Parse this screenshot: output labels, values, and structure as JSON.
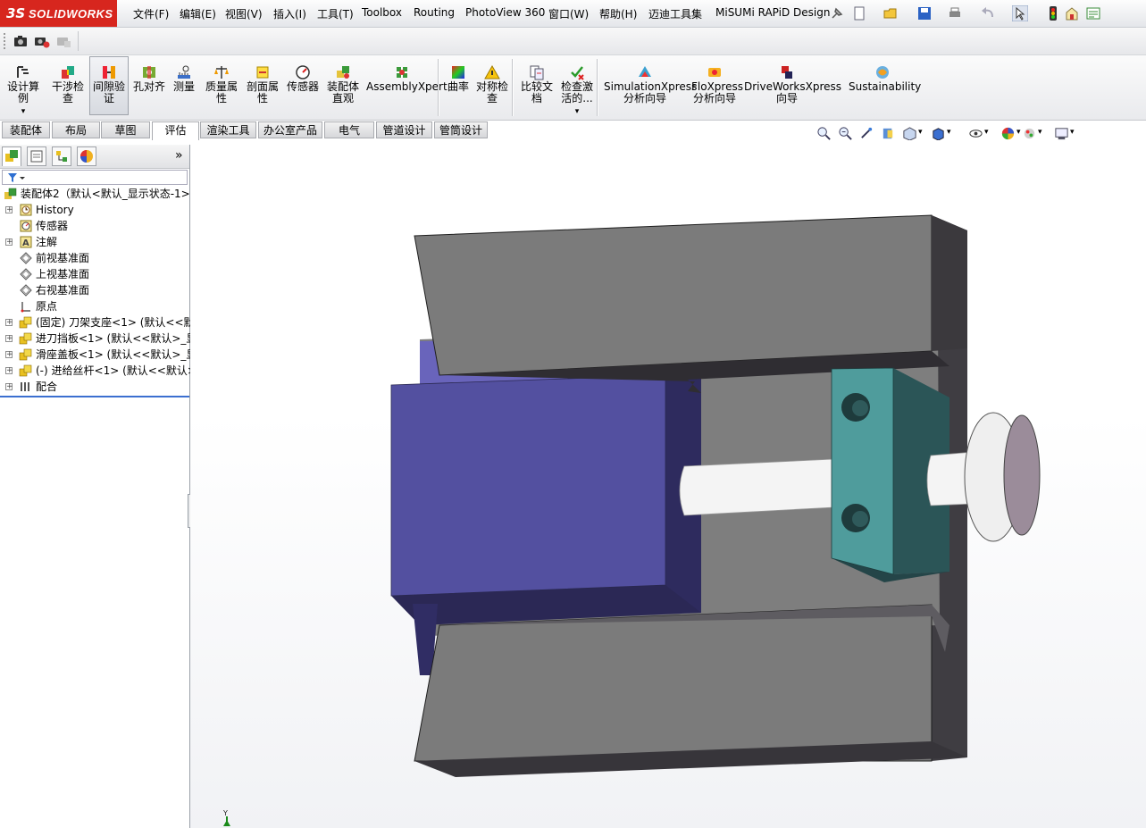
{
  "app": {
    "logo_ds": "3S",
    "logo_name": "SOLIDWORKS"
  },
  "menu": [
    {
      "label": "文件(F)",
      "name": "menu-file"
    },
    {
      "label": "编辑(E)",
      "name": "menu-edit"
    },
    {
      "label": "视图(V)",
      "name": "menu-view"
    },
    {
      "label": "插入(I)",
      "name": "menu-insert"
    },
    {
      "label": "工具(T)",
      "name": "menu-tools"
    },
    {
      "label": "Toolbox",
      "name": "menu-toolbox"
    },
    {
      "label": "Routing",
      "name": "menu-routing"
    },
    {
      "label": "PhotoView 360",
      "name": "menu-photoview"
    },
    {
      "label": "窗口(W)",
      "name": "menu-window"
    },
    {
      "label": "帮助(H)",
      "name": "menu-help"
    },
    {
      "label": "迈迪工具集",
      "name": "menu-maidi"
    },
    {
      "label": "MiSUMi RAPiD Design",
      "name": "menu-misumi"
    }
  ],
  "quick_access_icons": [
    "pin-icon",
    "new-document-icon",
    "open-folder-icon",
    "save-icon",
    "print-icon",
    "undo-icon",
    "select-arrow-icon",
    "traffic-light-icon",
    "options-icon",
    "customize-icon"
  ],
  "row2_icons": [
    "camera-icon",
    "camera-settings-icon",
    "camera-disabled-icon"
  ],
  "commands": [
    {
      "label": "设计算\n例",
      "name": "cmd-design-study",
      "icon": "design-study-icon",
      "dropdown": true
    },
    {
      "label": "干涉检\n查",
      "name": "cmd-interference-detection",
      "icon": "interference-icon"
    },
    {
      "label": "间隙验\n证",
      "name": "cmd-clearance-verification",
      "icon": "clearance-icon",
      "active": true
    },
    {
      "label": "孔对齐",
      "name": "cmd-hole-alignment",
      "icon": "hole-alignment-icon"
    },
    {
      "label": "测量",
      "name": "cmd-measure",
      "icon": "measure-icon"
    },
    {
      "label": "质量属\n性",
      "name": "cmd-mass-properties",
      "icon": "mass-properties-icon"
    },
    {
      "label": "剖面属\n性",
      "name": "cmd-section-properties",
      "icon": "section-properties-icon"
    },
    {
      "label": "传感器",
      "name": "cmd-sensor",
      "icon": "sensor-icon"
    },
    {
      "label": "装配体\n直观",
      "name": "cmd-assembly-visualization",
      "icon": "assembly-visualization-icon"
    },
    {
      "label": "AssemblyXpert",
      "name": "cmd-assemblyxpert",
      "icon": "assemblyxpert-icon"
    },
    {
      "label": "曲率",
      "name": "cmd-curvature",
      "icon": "curvature-icon"
    },
    {
      "label": "对称检\n查",
      "name": "cmd-symmetry-check",
      "icon": "symmetry-check-icon"
    },
    {
      "label": "比较文\n档",
      "name": "cmd-compare-documents",
      "icon": "compare-documents-icon"
    },
    {
      "label": "检查激\n活的...",
      "name": "cmd-check-active",
      "icon": "check-active-icon",
      "dropdown": true
    },
    {
      "label": "SimulationXpress\n分析向导",
      "name": "cmd-simulationxpress",
      "icon": "simulationxpress-icon"
    },
    {
      "label": "FloXpress\n分析向导",
      "name": "cmd-floxpress",
      "icon": "floxpress-icon"
    },
    {
      "label": "DriveWorksXpress\n向导",
      "name": "cmd-driveworksxpress",
      "icon": "driveworksxpress-icon"
    },
    {
      "label": "Sustainability",
      "name": "cmd-sustainability",
      "icon": "sustainability-icon"
    }
  ],
  "tabs": [
    {
      "label": "装配体",
      "name": "tab-assembly"
    },
    {
      "label": "布局",
      "name": "tab-layout"
    },
    {
      "label": "草图",
      "name": "tab-sketch"
    },
    {
      "label": "评估",
      "name": "tab-evaluate",
      "active": true
    },
    {
      "label": "渲染工具",
      "name": "tab-render-tools"
    },
    {
      "label": "办公室产品",
      "name": "tab-office-products"
    },
    {
      "label": "电气",
      "name": "tab-electrical"
    },
    {
      "label": "管道设计",
      "name": "tab-piping"
    },
    {
      "label": "管筒设计",
      "name": "tab-tubing"
    }
  ],
  "panel": {
    "tabs": [
      "feature-manager-icon",
      "property-manager-icon",
      "configuration-manager-icon",
      "display-manager-icon"
    ],
    "expand_label": "»",
    "filter_icon": "filter-icon"
  },
  "tree": [
    {
      "label": "装配体2（默认<默认_显示状态-1>)",
      "name": "tree-root-assembly",
      "icon": "assembly-icon",
      "indent": 0,
      "expandable": false
    },
    {
      "label": "History",
      "name": "tree-history",
      "icon": "history-icon",
      "indent": 1,
      "expandable": true
    },
    {
      "label": "传感器",
      "name": "tree-sensors",
      "icon": "sensor-folder-icon",
      "indent": 1,
      "expandable": false
    },
    {
      "label": "注解",
      "name": "tree-annotations",
      "icon": "annotation-icon",
      "indent": 1,
      "expandable": true
    },
    {
      "label": "前视基准面",
      "name": "tree-front-plane",
      "icon": "plane-icon",
      "indent": 1,
      "expandable": false
    },
    {
      "label": "上视基准面",
      "name": "tree-top-plane",
      "icon": "plane-icon",
      "indent": 1,
      "expandable": false
    },
    {
      "label": "右视基准面",
      "name": "tree-right-plane",
      "icon": "plane-icon",
      "indent": 1,
      "expandable": false
    },
    {
      "label": "原点",
      "name": "tree-origin",
      "icon": "origin-icon",
      "indent": 1,
      "expandable": false
    },
    {
      "label": "(固定) 刀架支座<1> (默认<<默",
      "name": "tree-part-tool-holder-base",
      "icon": "part-icon",
      "indent": 1,
      "expandable": true
    },
    {
      "label": "进刀挡板<1> (默认<<默认>_显",
      "name": "tree-part-feed-baffle",
      "icon": "part-icon",
      "indent": 1,
      "expandable": true
    },
    {
      "label": "滑座盖板<1> (默认<<默认>_显",
      "name": "tree-part-slide-cover",
      "icon": "part-icon",
      "indent": 1,
      "expandable": true
    },
    {
      "label": "(-) 进给丝杆<1> (默认<<默认>",
      "name": "tree-part-feed-screw",
      "icon": "part-icon",
      "indent": 1,
      "expandable": true
    },
    {
      "label": "配合",
      "name": "tree-mates",
      "icon": "mates-icon",
      "indent": 1,
      "expandable": true
    }
  ],
  "viewport": {
    "heads_up_icons": [
      "zoom-to-fit-icon",
      "zoom-to-area-icon",
      "previous-view-icon",
      "section-view-icon",
      "view-orientation-icon",
      "display-style-icon",
      "hide-show-items-icon",
      "edit-appearance-icon",
      "apply-scene-icon",
      "view-settings-icon"
    ],
    "triad_label": "Y"
  },
  "colors": {
    "base_face": "#7b7b7b",
    "base_side": "#3f3d42",
    "slide_cover_front": "#5350a0",
    "slide_cover_dark": "#2e2b5e",
    "bearing_block_front": "#4f9c9c",
    "bearing_block_side": "#2b5557",
    "shaft": "#f4f4f4",
    "handwheel_face": "#9b8c9a"
  }
}
